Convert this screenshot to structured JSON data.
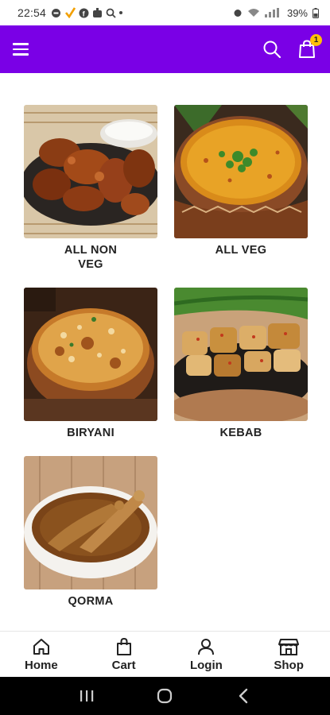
{
  "status_bar": {
    "time": "22:54",
    "battery": "39%"
  },
  "app_bar": {
    "cart_count": "1",
    "brand_color": "#7a00e6",
    "icons": [
      "menu-icon",
      "search-icon",
      "cart-bag-icon"
    ]
  },
  "categories": [
    {
      "label": "ALL NON VEG",
      "image": "grilled-chicken-wings-with-dip"
    },
    {
      "label": "ALL VEG",
      "image": "yellow-dal-in-clay-bowl"
    },
    {
      "label": "BIRYANI",
      "image": "chicken-biryani-in-pot"
    },
    {
      "label": "KEBAB",
      "image": "chicken-kebab-skewers"
    },
    {
      "label": "QORMA",
      "image": "chicken-qorma-in-white-bowl"
    }
  ],
  "bottom_nav": [
    {
      "label": "Home",
      "icon": "home-icon"
    },
    {
      "label": "Cart",
      "icon": "shopping-bag-icon"
    },
    {
      "label": "Login",
      "icon": "user-icon"
    },
    {
      "label": "Shop",
      "icon": "store-icon"
    }
  ],
  "system_nav": [
    "recents-icon",
    "home-circle-icon",
    "back-icon"
  ]
}
